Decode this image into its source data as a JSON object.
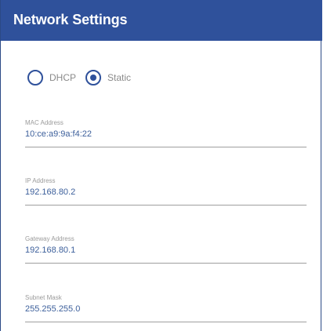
{
  "header": {
    "title": "Network Settings",
    "background_color": "#2f519b"
  },
  "mode": {
    "options": [
      {
        "label": "DHCP",
        "selected": false
      },
      {
        "label": "Static",
        "selected": true
      }
    ],
    "selected_value": "Static",
    "accent_color": "#2f519b"
  },
  "fields": {
    "mac": {
      "label": "MAC Address",
      "value": "10:ce:a9:9a:f4:22"
    },
    "ip": {
      "label": "IP Address",
      "value": "192.168.80.2"
    },
    "gateway": {
      "label": "Gateway Address",
      "value": "192.168.80.1"
    },
    "subnet": {
      "label": "Subnet Mask",
      "value": "255.255.255.0"
    }
  }
}
